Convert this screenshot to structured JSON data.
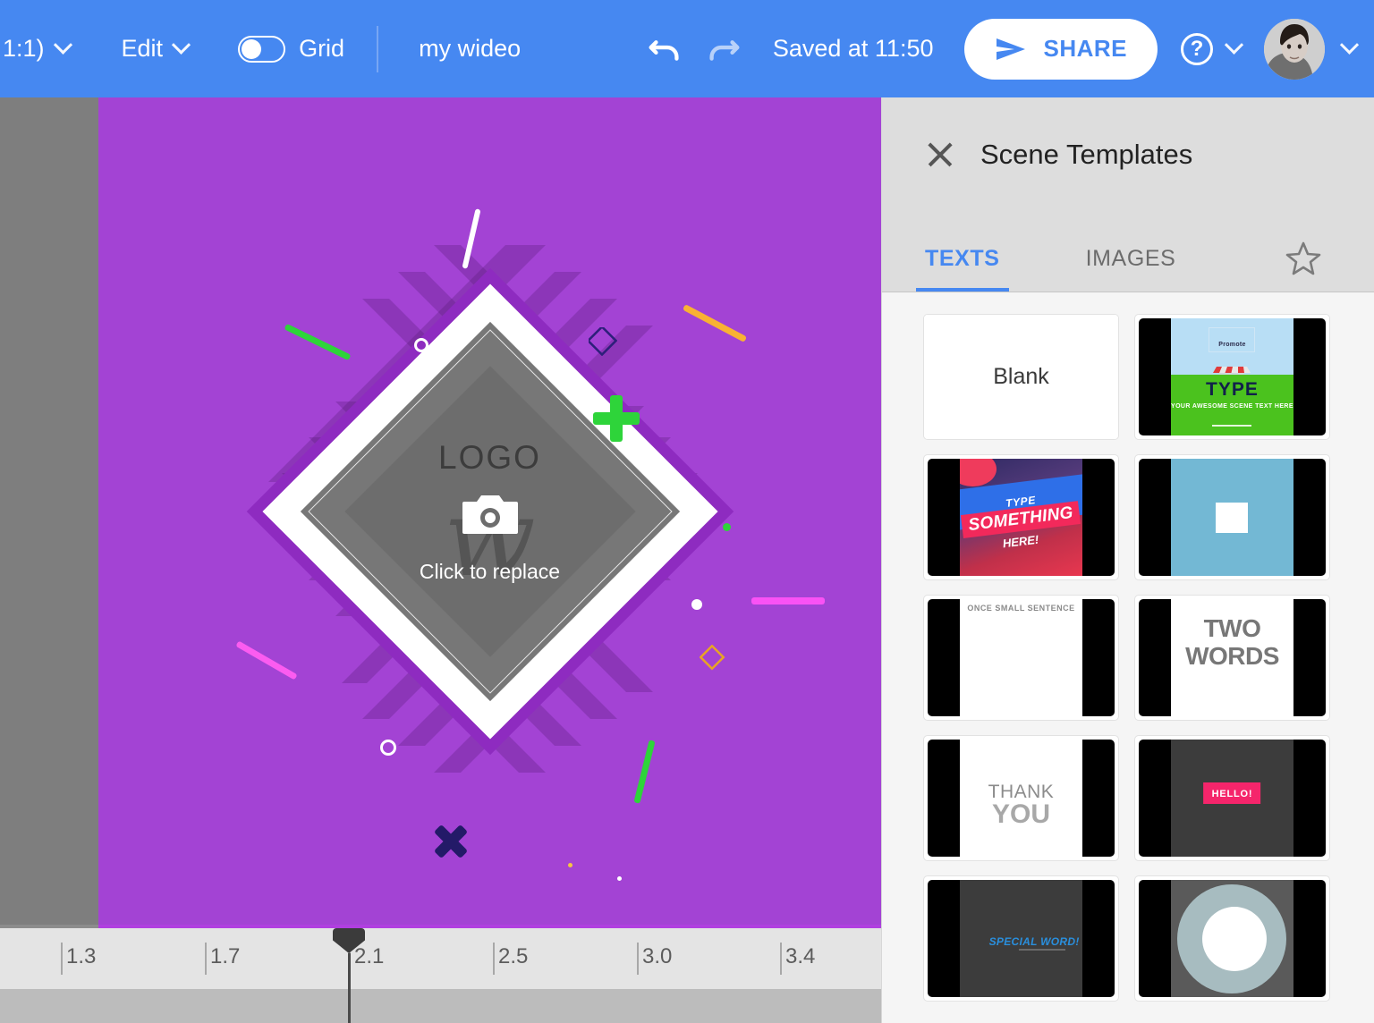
{
  "toolbar": {
    "ratio_label": "1:1)",
    "edit_label": "Edit",
    "grid_label": "Grid",
    "project_title": "my wideo",
    "undo_icon": "undo-icon",
    "redo_icon": "redo-icon",
    "saved_text": "Saved at 11:50",
    "share_label": "SHARE",
    "share_icon": "send-icon",
    "help_icon": "question-mark-icon",
    "avatar_icon": "user-avatar",
    "chevron_icon": "chevron-down-icon",
    "accent_color": "#4688f1"
  },
  "canvas": {
    "background_color": "#a343d4",
    "logo_label": "LOGO",
    "replace_label": "Click to replace",
    "camera_icon": "camera-icon",
    "watermark": "w",
    "decorations": [
      {
        "name": "white-line",
        "color": "#ffffff"
      },
      {
        "name": "green-line",
        "color": "#2ed43a"
      },
      {
        "name": "orange-line",
        "color": "#f9b233"
      },
      {
        "name": "pink-line",
        "color": "#fb5cf0"
      },
      {
        "name": "magenta-line",
        "color": "#f952f5"
      },
      {
        "name": "green-cross",
        "color": "#2ed43a"
      },
      {
        "name": "navy-cross",
        "color": "#231a68"
      },
      {
        "name": "navy-square",
        "color": "#2d1f7a"
      },
      {
        "name": "orange-square",
        "color": "#e8a424"
      },
      {
        "name": "white-ring",
        "color": "#ffffff"
      }
    ]
  },
  "timeline": {
    "ticks": [
      "1.3",
      "1.7",
      "2.1",
      "2.5",
      "3.0",
      "3.4"
    ],
    "playhead_value": "2.1",
    "playhead_icon": "playhead-marker"
  },
  "panel": {
    "title": "Scene Templates",
    "close_icon": "close-icon",
    "favorites_icon": "star-icon",
    "tabs": [
      {
        "label": "TEXTS",
        "active": true
      },
      {
        "label": "IMAGES",
        "active": false
      }
    ],
    "templates": [
      {
        "name": "blank",
        "label": "Blank"
      },
      {
        "name": "promote-shop",
        "title": "TYPE",
        "subtitle": "YOUR AWESOME SCENE TEXT HERE",
        "badge": "Promote"
      },
      {
        "name": "type-something-here",
        "line1": "TYPE",
        "line2": "SOMETHING",
        "line3": "HERE!"
      },
      {
        "name": "white-square-blue",
        "label": ""
      },
      {
        "name": "once-small-sentence",
        "label": "ONCE SMALL SENTENCE"
      },
      {
        "name": "two-words",
        "line1": "TWO",
        "line2": "WORDS"
      },
      {
        "name": "thank-you",
        "line1": "THANK",
        "line2": "YOU"
      },
      {
        "name": "hello",
        "label": "HELLO!"
      },
      {
        "name": "special-word",
        "label": "SPECIAL WORD!"
      },
      {
        "name": "circle-reveal",
        "label": ""
      }
    ]
  }
}
